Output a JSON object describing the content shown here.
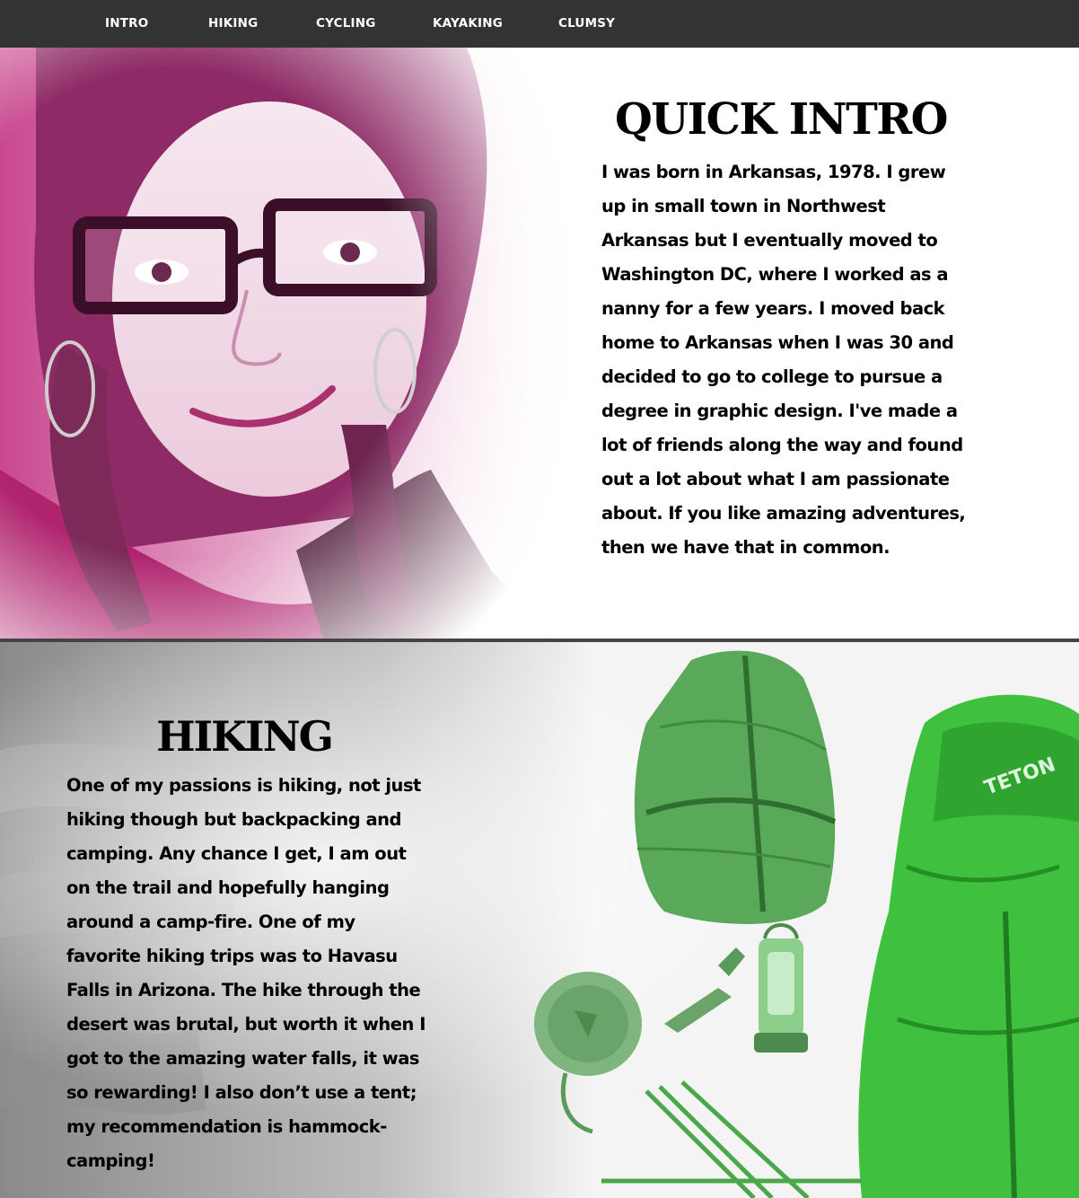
{
  "nav": {
    "items": [
      {
        "label": "INTRO"
      },
      {
        "label": "HIKING"
      },
      {
        "label": "CYCLING"
      },
      {
        "label": "KAYAKING"
      },
      {
        "label": "CLUMSY"
      }
    ]
  },
  "intro": {
    "title": "QUICK INTRO",
    "body": "I was born in Arkansas, 1978. I grew up in small town in Northwest Arkansas but I eventually moved to Washington DC, where I worked as a nanny for a few years. I moved back home to Arkansas when I was 30 and decided to go to college to pursue a degree in graphic design. I've made a lot of friends along the way and found out a lot about what I am passionate about. If you like amazing adventures, then we have that in common."
  },
  "hiking": {
    "title": "HIKING",
    "body": "One of my passions is hiking, not just hiking though but backpacking and camping. Any chance I get, I am out on the trail and hopefully hanging around a camp-fire. One of my favorite hiking trips was to Havasu Falls in Arizona. The hike through the desert was brutal, but worth it when I got to the amazing water falls, it was so rewarding! I also don’t use a tent; my recommendation is hammock-camping!",
    "gear_brand": "TETON"
  },
  "colors": {
    "nav_bg": "#333333",
    "portrait_tint": "#d6198c",
    "gear_tint": "#3ec43e",
    "text": "#000000"
  }
}
